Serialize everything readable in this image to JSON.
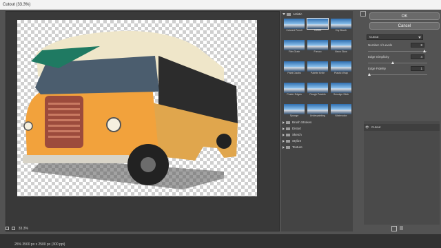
{
  "window": {
    "title": "Cutout (33.3%)"
  },
  "preview": {
    "zoom": "33.3%"
  },
  "gallery": {
    "folder_open": "Artistic",
    "thumbnails": [
      "Colored Pencil",
      "Cutout",
      "Dry Brush",
      "Film Grain",
      "Fresco",
      "Neon Glow",
      "Paint Daubs",
      "Palette Knife",
      "Plastic Wrap",
      "Poster Edges",
      "Rough Pastels",
      "Smudge Stick",
      "Sponge",
      "Underpainting",
      "Watercolor"
    ],
    "selected_index": 1,
    "folders": [
      "Brush Strokes",
      "Distort",
      "Sketch",
      "Stylize",
      "Texture"
    ]
  },
  "buttons": {
    "ok": "OK",
    "cancel": "Cancel"
  },
  "filter_select": {
    "value": "Cutout"
  },
  "params": [
    {
      "label": "Number of Levels",
      "value": "8",
      "fraction": 0.95
    },
    {
      "label": "Edge Simplicity",
      "value": "4",
      "fraction": 0.4
    },
    {
      "label": "Edge Fidelity",
      "value": "1",
      "fraction": 0.0
    }
  ],
  "layers": {
    "item": "Cutout"
  },
  "status": {
    "text": "25%   3500 px x 2500 px (300 ppi)"
  }
}
